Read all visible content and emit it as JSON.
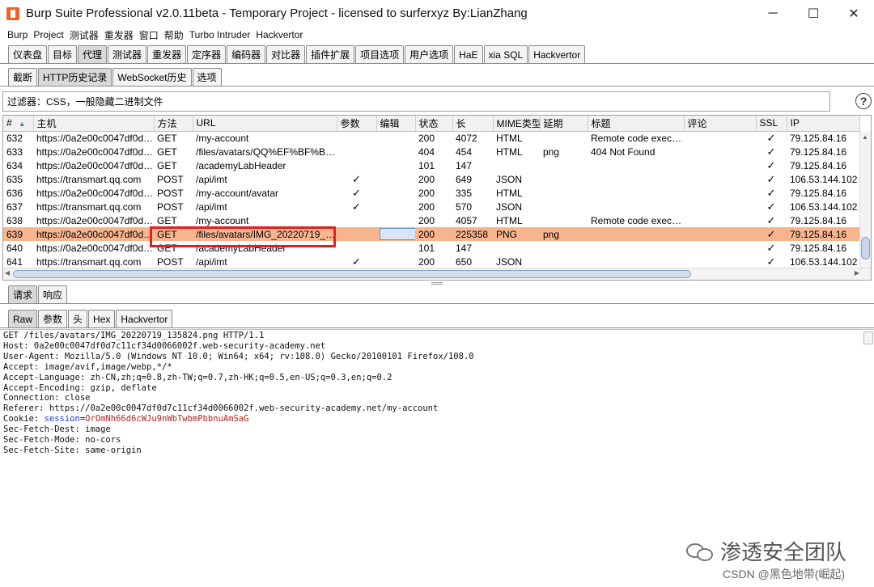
{
  "window": {
    "title": "Burp Suite Professional v2.0.11beta - Temporary Project - licensed to surferxyz By:LianZhang",
    "minimize": "─",
    "maximize": "☐",
    "close": "✕"
  },
  "menu": [
    "Burp",
    "Project",
    "测试器",
    "重发器",
    "窗口",
    "帮助",
    "Turbo Intruder",
    "Hackvertor"
  ],
  "main_tabs": {
    "items": [
      "仪表盘",
      "目标",
      "代理",
      "测试器",
      "重发器",
      "定序器",
      "编码器",
      "对比器",
      "插件扩展",
      "项目选项",
      "用户选项",
      "HaE",
      "xia SQL",
      "Hackvertor"
    ],
    "active": "代理"
  },
  "proxy_tabs": {
    "items": [
      "截断",
      "HTTP历史记录",
      "WebSocket历史",
      "选项"
    ],
    "active": "HTTP历史记录"
  },
  "filter": {
    "text": "过滤器：CSS，一般隐藏二进制文件",
    "help": "?"
  },
  "table": {
    "columns": [
      "#",
      "主机",
      "方法",
      "URL",
      "参数",
      "编辑",
      "状态",
      "长",
      "MIME类型",
      "延期",
      "标题",
      "评论",
      "SSL",
      "IP"
    ],
    "sort_indicator": "▲",
    "check": "✓",
    "rows": [
      {
        "num": "632",
        "host": "https://0a2e00c0047df0d7...",
        "method": "GET",
        "url": "/my-account",
        "params": false,
        "status": "200",
        "length": "4072",
        "mime": "HTML",
        "ext": "",
        "title": "Remote code execu...",
        "ssl": true,
        "ip": "79.125.84.16"
      },
      {
        "num": "633",
        "host": "https://0a2e00c0047df0d7...",
        "method": "GET",
        "url": "/files/avatars/QQ%EF%BF%BD...",
        "params": false,
        "status": "404",
        "length": "454",
        "mime": "HTML",
        "ext": "png",
        "title": "404 Not Found",
        "ssl": true,
        "ip": "79.125.84.16"
      },
      {
        "num": "634",
        "host": "https://0a2e00c0047df0d7...",
        "method": "GET",
        "url": "/academyLabHeader",
        "params": false,
        "status": "101",
        "length": "147",
        "mime": "",
        "ext": "",
        "title": "",
        "ssl": true,
        "ip": "79.125.84.16"
      },
      {
        "num": "635",
        "host": "https://transmart.qq.com",
        "method": "POST",
        "url": "/api/imt",
        "params": true,
        "status": "200",
        "length": "649",
        "mime": "JSON",
        "ext": "",
        "title": "",
        "ssl": true,
        "ip": "106.53.144.102"
      },
      {
        "num": "636",
        "host": "https://0a2e00c0047df0d7...",
        "method": "POST",
        "url": "/my-account/avatar",
        "params": true,
        "status": "200",
        "length": "335",
        "mime": "HTML",
        "ext": "",
        "title": "",
        "ssl": true,
        "ip": "79.125.84.16"
      },
      {
        "num": "637",
        "host": "https://transmart.qq.com",
        "method": "POST",
        "url": "/api/imt",
        "params": true,
        "status": "200",
        "length": "570",
        "mime": "JSON",
        "ext": "",
        "title": "",
        "ssl": true,
        "ip": "106.53.144.102"
      },
      {
        "num": "638",
        "host": "https://0a2e00c0047df0d7...",
        "method": "GET",
        "url": "/my-account",
        "params": false,
        "status": "200",
        "length": "4057",
        "mime": "HTML",
        "ext": "",
        "title": "Remote code execu...",
        "ssl": true,
        "ip": "79.125.84.16"
      },
      {
        "num": "639",
        "host": "https://0a2e00c0047df0d7...",
        "method": "GET",
        "url": "/files/avatars/IMG_20220719_13...",
        "params": false,
        "status": "200",
        "length": "225358",
        "mime": "PNG",
        "ext": "png",
        "title": "",
        "ssl": true,
        "ip": "79.125.84.16",
        "selected": true
      },
      {
        "num": "640",
        "host": "https://0a2e00c0047df0d7...",
        "method": "GET",
        "url": "/academyLabHeader",
        "params": false,
        "status": "101",
        "length": "147",
        "mime": "",
        "ext": "",
        "title": "",
        "ssl": true,
        "ip": "79.125.84.16"
      },
      {
        "num": "641",
        "host": "https://transmart.qq.com",
        "method": "POST",
        "url": "/api/imt",
        "params": true,
        "status": "200",
        "length": "650",
        "mime": "JSON",
        "ext": "",
        "title": "",
        "ssl": true,
        "ip": "106.53.144.102"
      }
    ]
  },
  "detail_tabs": {
    "items": [
      "请求",
      "响应"
    ],
    "active": "请求"
  },
  "view_tabs": {
    "items": [
      "Raw",
      "参数",
      "头",
      "Hex",
      "Hackvertor"
    ],
    "active": "Raw"
  },
  "request": {
    "lines_before": [
      "GET /files/avatars/IMG_20220719_135824.png HTTP/1.1",
      "Host: 0a2e00c0047df0d7c11cf34d0066002f.web-security-academy.net",
      "User-Agent: Mozilla/5.0 (Windows NT 10.0; Win64; x64; rv:108.0) Gecko/20100101 Firefox/108.0",
      "Accept: image/avif,image/webp,*/*",
      "Accept-Language: zh-CN,zh;q=0.8,zh-TW;q=0.7,zh-HK;q=0.5,en-US;q=0.3,en;q=0.2",
      "Accept-Encoding: gzip, deflate",
      "Connection: close",
      "Referer: https://0a2e00c0047df0d7c11cf34d0066002f.web-security-academy.net/my-account"
    ],
    "cookie_prefix": "Cookie: ",
    "cookie_key": "session",
    "cookie_eq": "=",
    "cookie_value": "OrOmNh66d6cWJu9nWbTwbmPbbnuAmSaG",
    "lines_after": [
      "Sec-Fetch-Dest: image",
      "Sec-Fetch-Mode: no-cors",
      "Sec-Fetch-Site: same-origin"
    ]
  },
  "watermark": {
    "main": "渗透安全团队",
    "csdn": "CSDN @黑色地带(崛起)"
  },
  "colors": {
    "selected_row": "#f7b58f",
    "highlight_box": "#e02020",
    "cookie_key": "#1e3fcf",
    "cookie_value": "#b3261e"
  }
}
